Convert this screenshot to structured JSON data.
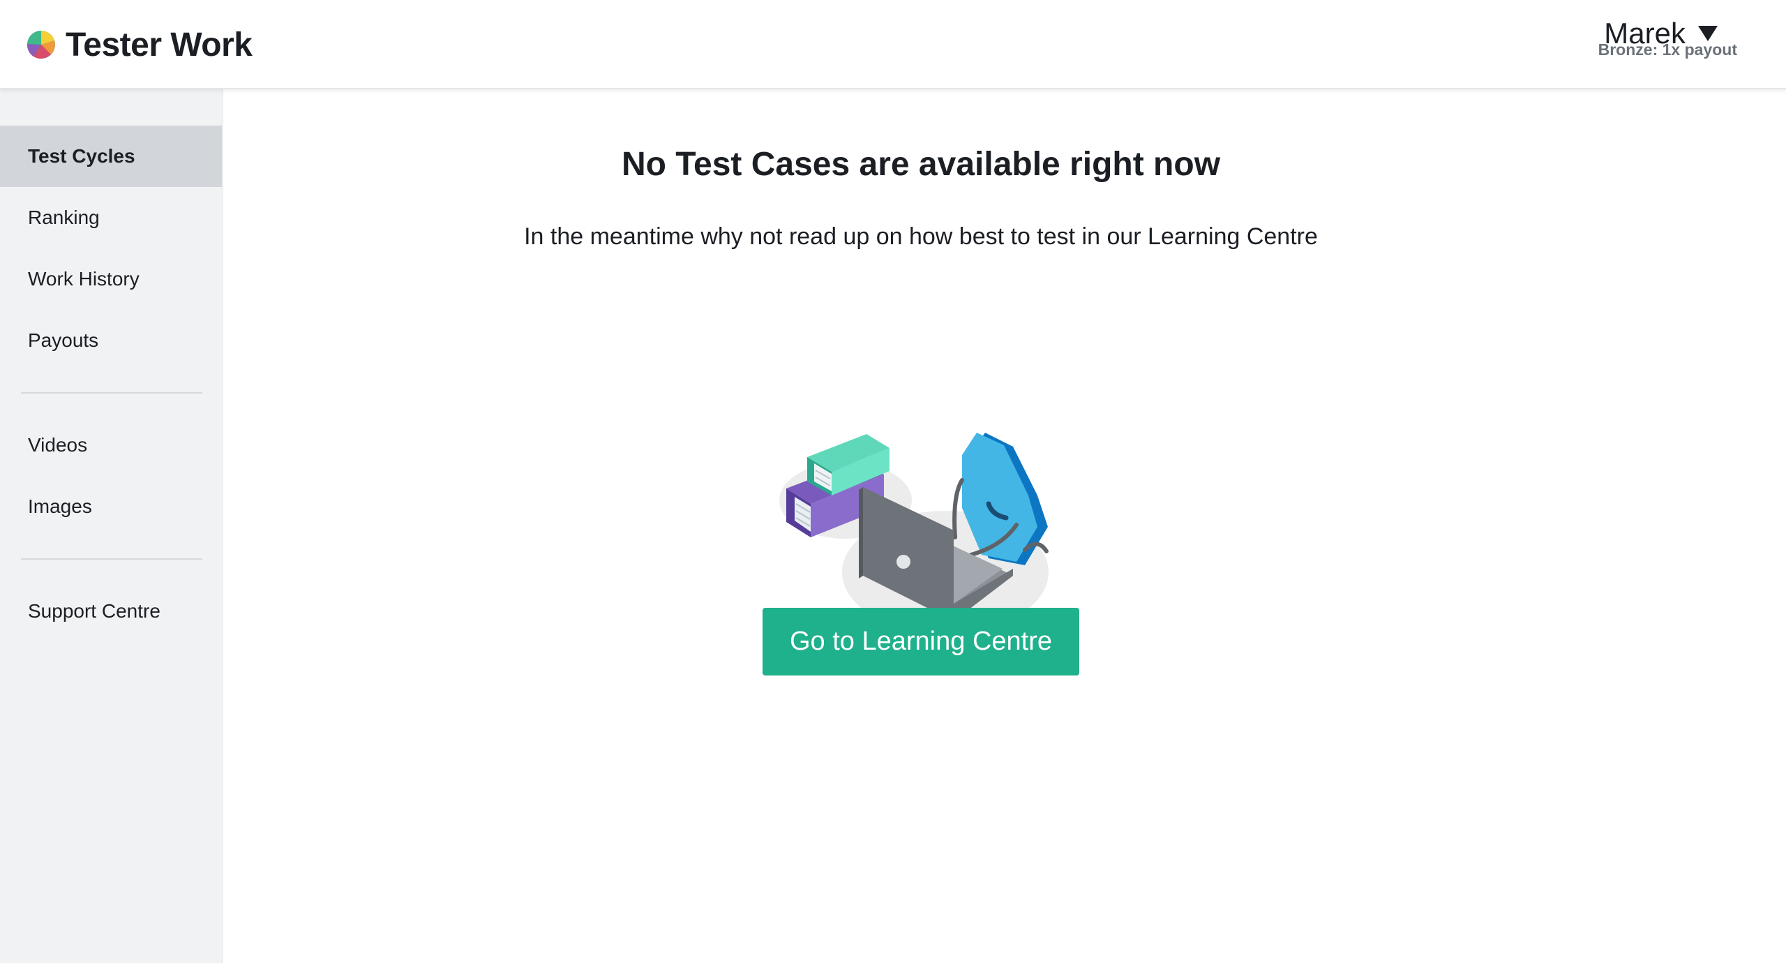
{
  "app": {
    "title": "Tester Work",
    "logo_icon": "color-wheel-logo"
  },
  "user": {
    "name": "Marek",
    "tier": "Bronze: 1x payout",
    "menu_icon": "caret-down-icon"
  },
  "sidebar": {
    "groups": [
      [
        {
          "label": "Test Cycles",
          "active": true
        },
        {
          "label": "Ranking",
          "active": false
        },
        {
          "label": "Work History",
          "active": false
        },
        {
          "label": "Payouts",
          "active": false
        }
      ],
      [
        {
          "label": "Videos",
          "active": false
        },
        {
          "label": "Images",
          "active": false
        }
      ],
      [
        {
          "label": "Support Centre",
          "active": false
        }
      ]
    ]
  },
  "main": {
    "heading": "No Test Cases are available right now",
    "subtext": "In the meantime why not read up on how best to test in our Learning Centre",
    "illustration": "books-laptop-shield-illustration",
    "cta_label": "Go to Learning Centre"
  },
  "colors": {
    "accent": "#1fb08c",
    "sidebar_bg": "#f1f2f4",
    "active_item_bg": "#d2d5d9"
  }
}
